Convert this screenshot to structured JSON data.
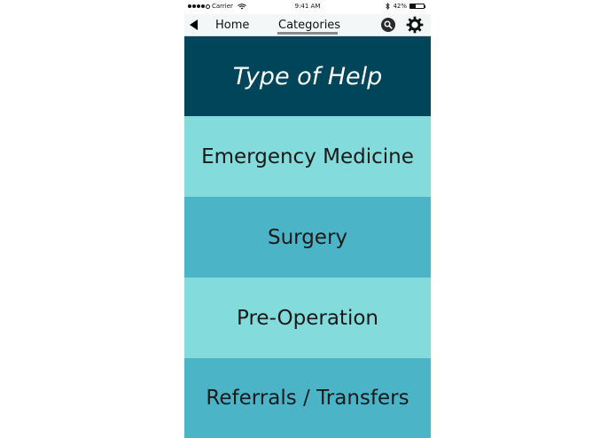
{
  "status_bar": {
    "carrier": "Carrier",
    "time": "9:41 AM",
    "battery": "42%",
    "battery_level": 0.42
  },
  "nav": {
    "home_label": "Home",
    "categories_label": "Categories"
  },
  "banner": {
    "title": "Type of Help"
  },
  "categories": [
    {
      "label": "Emergency Medicine"
    },
    {
      "label": "Surgery"
    },
    {
      "label": "Pre-Operation"
    },
    {
      "label": "Referrals / Transfers"
    }
  ],
  "colors": {
    "banner_bg": "#004559",
    "light_row": "#84dbdb",
    "dark_row": "#4bb4c6"
  }
}
